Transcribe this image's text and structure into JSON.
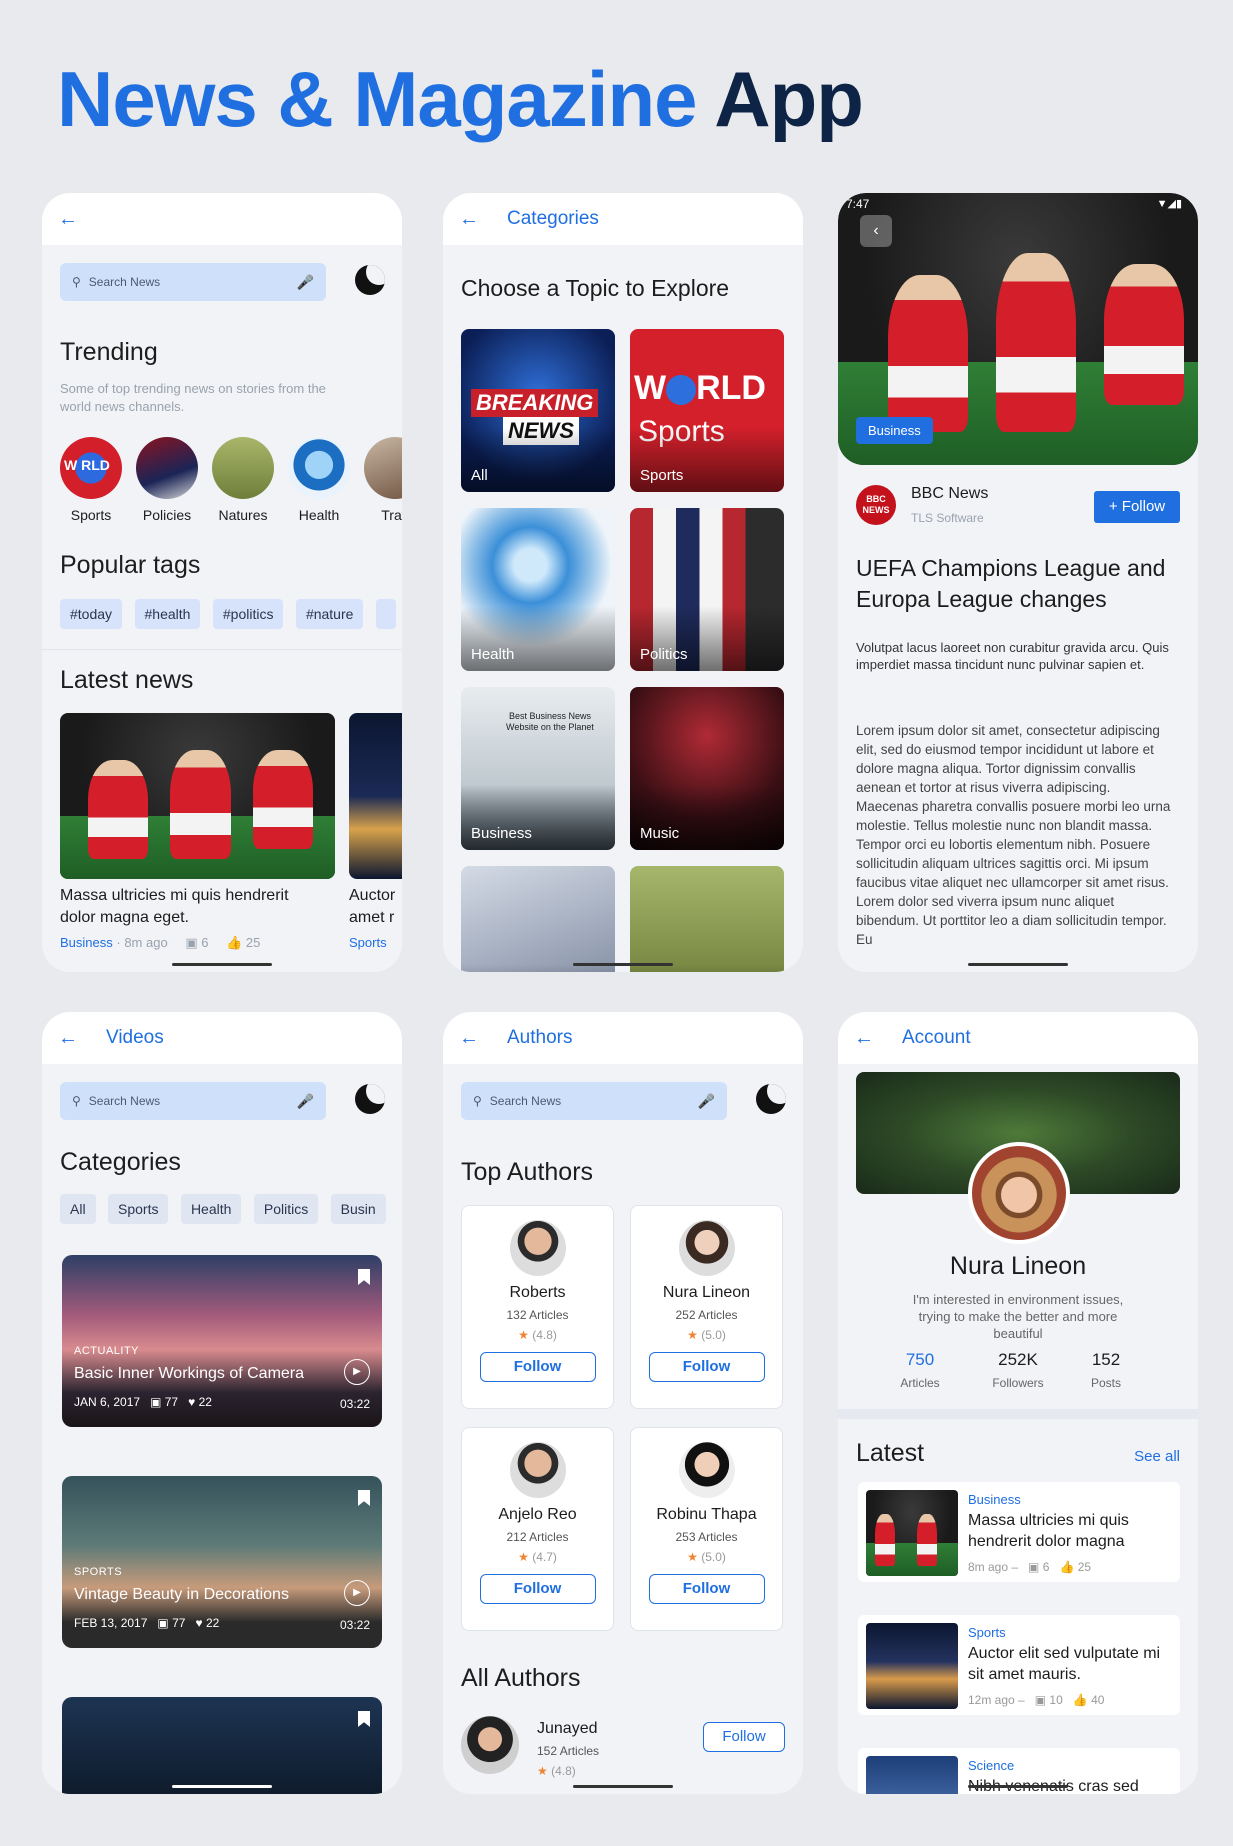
{
  "hero": {
    "title_a": "News & Magazine",
    "title_b": "App"
  },
  "screen1": {
    "search_placeholder": "Search News",
    "trending_title": "Trending",
    "trending_desc": "Some of top trending news on stories from the world news channels.",
    "trending_items": [
      "Sports",
      "Policies",
      "Natures",
      "Health",
      "Trav"
    ],
    "popular_title": "Popular tags",
    "tags": [
      "#today",
      "#health",
      "#politics",
      "#nature"
    ],
    "latest_title": "Latest news",
    "card1": {
      "title": "Massa ultricies mi quis hendrerit dolor magna eget.",
      "category": "Business",
      "time": "8m ago",
      "comments": "6",
      "likes": "25"
    },
    "card2": {
      "title": "Auctor amet r",
      "category": "Sports"
    }
  },
  "screen2": {
    "topbar_title": "Categories",
    "heading": "Choose a Topic to Explore",
    "tiles": [
      "All",
      "Sports",
      "Health",
      "Politics",
      "Business",
      "Music"
    ],
    "breaking": [
      "BREAKING",
      "NEWS"
    ],
    "world": [
      "W",
      "RLD",
      "Sports"
    ],
    "business_caption": "Best Business News Website on the Planet"
  },
  "screen3": {
    "time": "7:47",
    "badge": "Business",
    "source": "BBC News",
    "source_logo": "BBC NEWS",
    "source_sub": "TLS Software",
    "follow": "+ Follow",
    "headline": "UEFA Champions League and Europa League changes",
    "lead": "Volutpat lacus laoreet non curabitur gravida arcu. Quis imperdiet massa tincidunt nunc pulvinar sapien et.",
    "body": "Lorem ipsum dolor sit amet, consectetur adipiscing elit, sed do eiusmod tempor incididunt ut labore et dolore magna aliqua. Tortor dignissim convallis aenean et tortor at risus viverra adipiscing. Maecenas pharetra convallis posuere morbi leo urna molestie. Tellus molestie nunc non blandit massa. Tempor orci eu lobortis elementum nibh. Posuere sollicitudin aliquam ultrices sagittis orci. Mi ipsum faucibus vitae aliquet nec ullamcorper sit amet risus. Lorem dolor sed viverra ipsum nunc aliquet bibendum. Ut porttitor leo a diam sollicitudin tempor. Eu"
  },
  "screen4": {
    "topbar_title": "Videos",
    "search_placeholder": "Search News",
    "categories_title": "Categories",
    "chips": [
      "All",
      "Sports",
      "Health",
      "Politics",
      "Busin"
    ],
    "videos": [
      {
        "category": "ACTUALITY",
        "title": "Basic Inner Workings of Camera",
        "date": "JAN 6, 2017",
        "comments": "77",
        "likes": "22",
        "duration": "03:22"
      },
      {
        "category": "SPORTS",
        "title": "Vintage Beauty in Decorations",
        "date": "FEB 13, 2017",
        "comments": "77",
        "likes": "22",
        "duration": "03:22"
      }
    ]
  },
  "screen5": {
    "topbar_title": "Authors",
    "search_placeholder": "Search News",
    "top_title": "Top Authors",
    "authors": [
      {
        "name": "Roberts",
        "articles": "132 Articles",
        "rating": "(4.8)"
      },
      {
        "name": "Nura Lineon",
        "articles": "252 Articles",
        "rating": "(5.0)"
      },
      {
        "name": "Anjelo Reo",
        "articles": "212 Articles",
        "rating": "(4.7)"
      },
      {
        "name": "Robinu Thapa",
        "articles": "253 Articles",
        "rating": "(5.0)"
      }
    ],
    "follow": "Follow",
    "all_title": "All Authors",
    "all_first": {
      "name": "Junayed",
      "articles": "152 Articles",
      "rating": "(4.8)"
    }
  },
  "screen6": {
    "topbar_title": "Account",
    "name": "Nura Lineon",
    "bio": "I'm interested in environment issues, trying to make the better and more beautiful",
    "stats": [
      {
        "value": "750",
        "label": "Articles"
      },
      {
        "value": "252K",
        "label": "Followers"
      },
      {
        "value": "152",
        "label": "Posts"
      }
    ],
    "latest_title": "Latest",
    "see_all": "See all",
    "items": [
      {
        "category": "Business",
        "title": "Massa ultricies mi quis hendrerit dolor magna",
        "time": "8m ago",
        "comments": "6",
        "likes": "25"
      },
      {
        "category": "Sports",
        "title": "Auctor elit sed vulputate mi sit amet mauris.",
        "time": "12m ago",
        "comments": "10",
        "likes": "40"
      },
      {
        "category": "Science",
        "title": "Nibh venenatis cras sed"
      }
    ]
  },
  "colors": {
    "accent": "#1f6fe0",
    "navy": "#0e2446",
    "chip": "#d6e3fb",
    "star": "#f0832f"
  }
}
